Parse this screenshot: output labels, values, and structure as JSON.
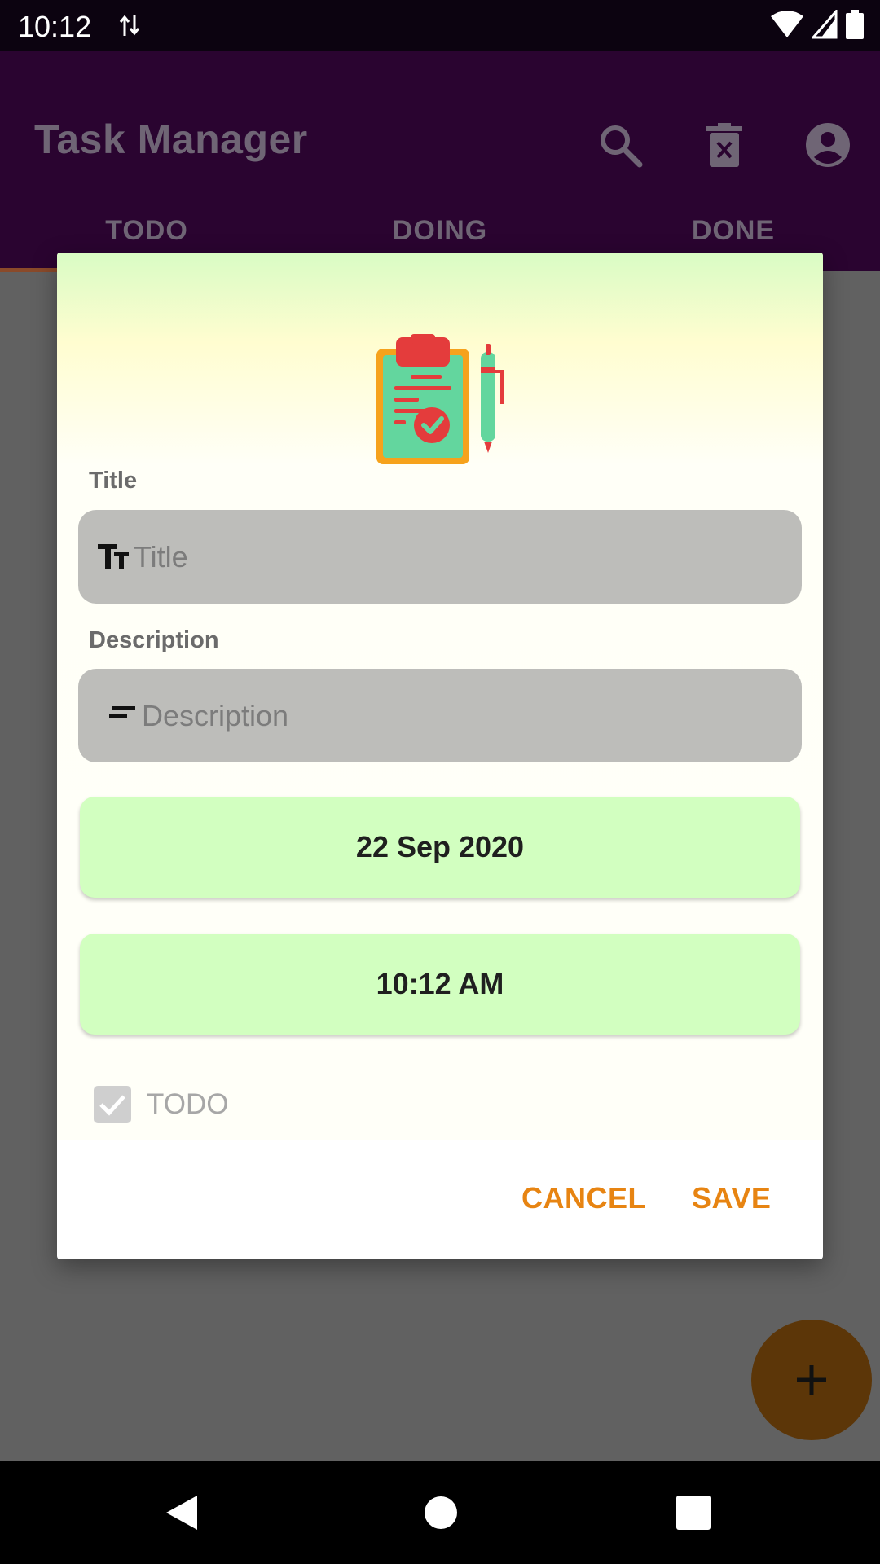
{
  "status_bar": {
    "time": "10:12"
  },
  "app_bar": {
    "title": "Task Manager",
    "actions": [
      "search-icon",
      "delete-icon",
      "account-icon"
    ],
    "tabs": [
      {
        "label": "TODO"
      },
      {
        "label": "DOING"
      },
      {
        "label": "DONE"
      }
    ],
    "selected_tab": "TODO"
  },
  "dialog": {
    "title_label": "Title",
    "title_placeholder": "Title",
    "description_label": "Description",
    "description_placeholder": "Description",
    "date": "22 Sep 2020",
    "time": "10:12 AM",
    "status_checkbox": {
      "label": "TODO",
      "checked": true
    },
    "cancel_label": "CANCEL",
    "save_label": "SAVE"
  },
  "fab": {
    "icon": "add-icon"
  },
  "colors": {
    "app_bar": "#2a0430",
    "accent": "#e78412",
    "date_button": "#d2ffc0",
    "field_bg": "#bdbdba",
    "fab": "#5c3608"
  }
}
